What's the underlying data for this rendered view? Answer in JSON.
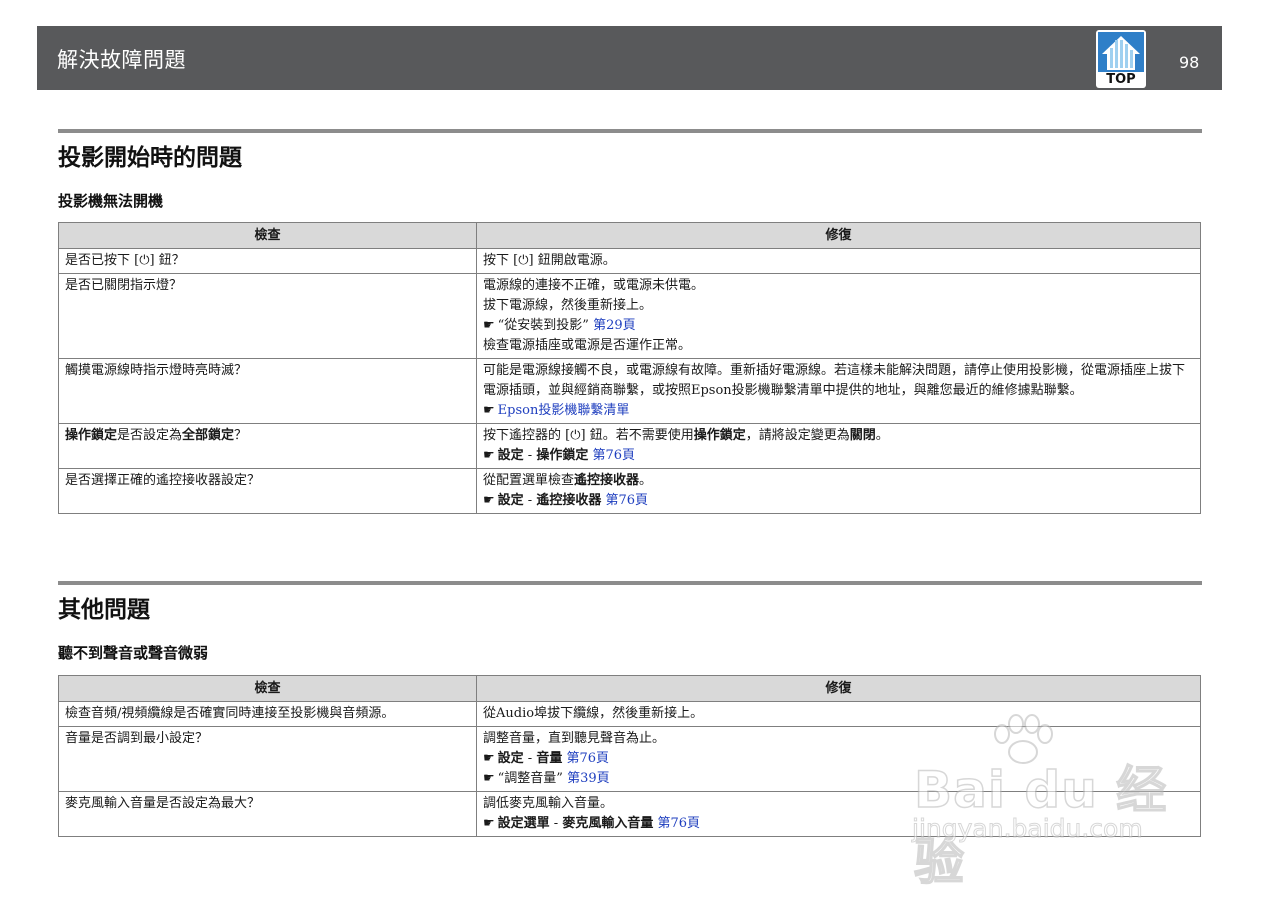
{
  "header": {
    "title": "解決故障問題",
    "top_label": "TOP",
    "page_number": "98"
  },
  "sections": [
    {
      "title": "投影開始時的問題",
      "subsection": "投影機無法開機",
      "columns": [
        "檢查",
        "修復"
      ],
      "rows": [
        {
          "check_parts": [
            {
              "t": "是否已按下 [⏻] 鈕？",
              "b": false
            }
          ],
          "fix": [
            {
              "parts": [
                {
                  "t": "按下 [⏻] 鈕開啟電源。",
                  "b": false
                }
              ]
            }
          ]
        },
        {
          "check_parts": [
            {
              "t": "是否已關閉指示燈？",
              "b": false
            }
          ],
          "fix": [
            {
              "parts": [
                {
                  "t": "電源線的連接不正確，或電源未供電。",
                  "b": false
                }
              ]
            },
            {
              "parts": [
                {
                  "t": "拔下電源線，然後重新接上。",
                  "b": false
                }
              ]
            },
            {
              "ref": true,
              "parts": [
                {
                  "t": "“從安裝到投影”",
                  "b": false
                },
                {
                  "t": " 第29頁",
                  "link": true
                }
              ]
            },
            {
              "parts": [
                {
                  "t": "檢查電源插座或電源是否運作正常。",
                  "b": false
                }
              ]
            }
          ]
        },
        {
          "check_parts": [
            {
              "t": "觸摸電源線時指示燈時亮時滅？",
              "b": false
            }
          ],
          "fix": [
            {
              "parts": [
                {
                  "t": "可能是電源線接觸不良，或電源線有故障。重新插好電源線。若這樣未能解決問題，請停止使用投影機，從電源插座上拔下電源插頭，並與經銷商聯繫，或按照Epson投影機聯繫清單中提供的地址，與離您最近的維修據點聯繫。",
                  "b": false
                }
              ]
            },
            {
              "ref": true,
              "parts": [
                {
                  "t": "Epson投影機聯繫清單",
                  "link": true
                }
              ]
            }
          ]
        },
        {
          "check_parts": [
            {
              "t": "操作鎖定",
              "b": true
            },
            {
              "t": "是否設定為",
              "b": false
            },
            {
              "t": "全部鎖定",
              "b": true
            },
            {
              "t": "？",
              "b": false
            }
          ],
          "fix": [
            {
              "parts": [
                {
                  "t": "按下遙控器的 [⏻] 鈕。若不需要使用",
                  "b": false
                },
                {
                  "t": "操作鎖定",
                  "b": true
                },
                {
                  "t": "，請將設定變更為",
                  "b": false
                },
                {
                  "t": "關閉",
                  "b": true
                },
                {
                  "t": "。",
                  "b": false
                }
              ]
            },
            {
              "ref": true,
              "parts": [
                {
                  "t": "設定",
                  "b": true
                },
                {
                  "t": " - ",
                  "b": false
                },
                {
                  "t": "操作鎖定",
                  "b": true
                },
                {
                  "t": " 第76頁",
                  "link": true
                }
              ]
            }
          ]
        },
        {
          "check_parts": [
            {
              "t": "是否選擇正確的遙控接收器設定？",
              "b": false
            }
          ],
          "fix": [
            {
              "parts": [
                {
                  "t": "從配置選單檢查",
                  "b": false
                },
                {
                  "t": "遙控接收器",
                  "b": true
                },
                {
                  "t": "。",
                  "b": false
                }
              ]
            },
            {
              "ref": true,
              "parts": [
                {
                  "t": "設定",
                  "b": true
                },
                {
                  "t": " - ",
                  "b": false
                },
                {
                  "t": "遙控接收器",
                  "b": true
                },
                {
                  "t": " 第76頁",
                  "link": true
                }
              ]
            }
          ]
        }
      ]
    },
    {
      "title": "其他問題",
      "subsection": "聽不到聲音或聲音微弱",
      "columns": [
        "檢查",
        "修復"
      ],
      "rows": [
        {
          "check_parts": [
            {
              "t": "檢查音頻/視頻纜線是否確實同時連接至投影機與音頻源。",
              "b": false
            }
          ],
          "fix": [
            {
              "parts": [
                {
                  "t": "從Audio埠拔下纜線，然後重新接上。",
                  "b": false
                }
              ]
            }
          ]
        },
        {
          "check_parts": [
            {
              "t": "音量是否調到最小設定？",
              "b": false
            }
          ],
          "fix": [
            {
              "parts": [
                {
                  "t": "調整音量，直到聽見聲音為止。",
                  "b": false
                }
              ]
            },
            {
              "ref": true,
              "parts": [
                {
                  "t": "設定",
                  "b": true
                },
                {
                  "t": " - ",
                  "b": false
                },
                {
                  "t": "音量",
                  "b": true
                },
                {
                  "t": " 第76頁",
                  "link": true
                }
              ]
            },
            {
              "ref": true,
              "parts": [
                {
                  "t": "“調整音量”",
                  "b": false
                },
                {
                  "t": " 第39頁",
                  "link": true
                }
              ]
            }
          ]
        },
        {
          "check_parts": [
            {
              "t": "麥克風輸入音量是否設定為最大？",
              "b": false
            }
          ],
          "fix": [
            {
              "parts": [
                {
                  "t": "調低麥克風輸入音量。",
                  "b": false
                }
              ]
            },
            {
              "ref": true,
              "parts": [
                {
                  "t": "設定選單",
                  "b": true
                },
                {
                  "t": " - ",
                  "b": false
                },
                {
                  "t": "麥克風輸入音量",
                  "b": true
                },
                {
                  "t": " 第76頁",
                  "link": true
                }
              ]
            }
          ]
        }
      ]
    }
  ],
  "watermark": {
    "brand": "Bai du 经验",
    "url": "jingyan.baidu.com"
  },
  "colors": {
    "header_bg": "#58595b",
    "link": "#1f3fbf",
    "table_header_bg": "#d9d9d9",
    "top_icon": "#3d8fd4"
  }
}
